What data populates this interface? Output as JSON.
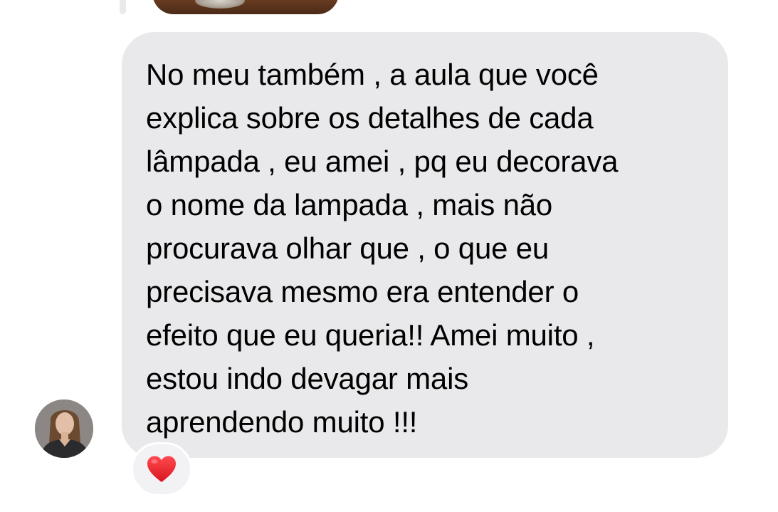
{
  "message": {
    "text": "No meu também , a aula que você\nexplica sobre os detalhes de cada\nlâmpada , eu amei , pq eu decorava\no nome da lampada , mais não\nprocurava olhar que , o que eu\nprecisava mesmo era entender o\nefeito que eu queria!! Amei muito ,\nestou indo devagar mais\naprendendo muito !!!",
    "bubble_color": "#e9e9eb",
    "text_color": "#000000"
  },
  "reaction": {
    "icon": "red-heart-icon",
    "color": "#e0202a"
  },
  "sender": {
    "avatar_icon": "user-avatar"
  },
  "previous_message": {
    "type": "media-thumbnail"
  }
}
